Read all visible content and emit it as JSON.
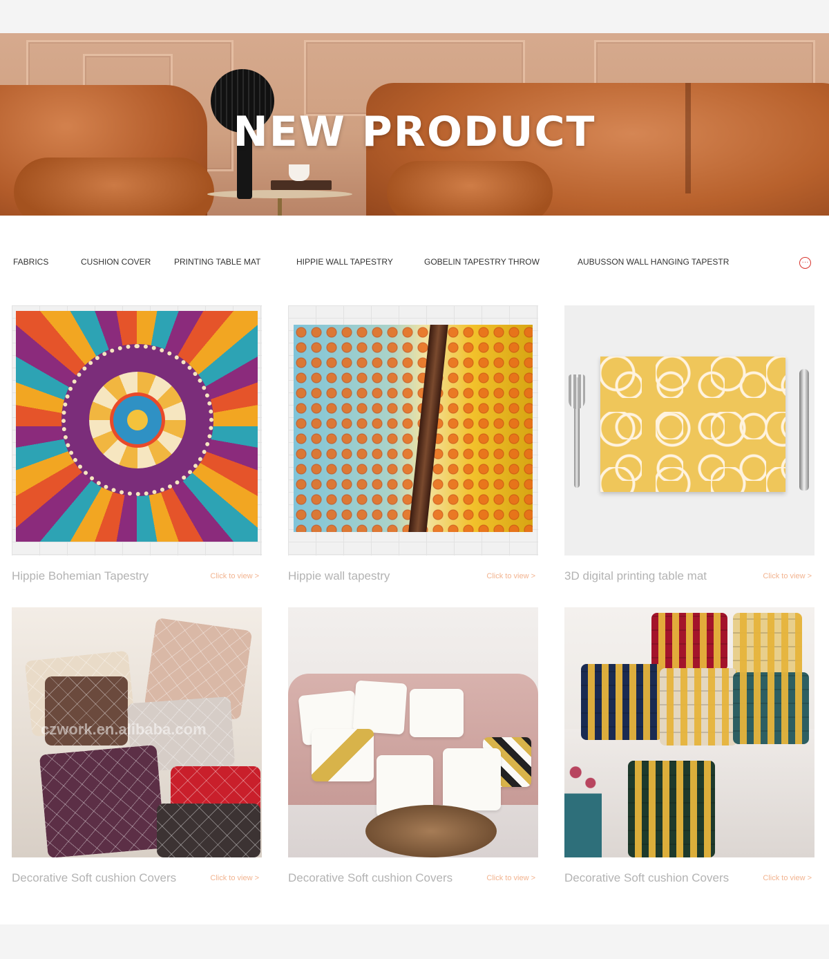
{
  "banner": {
    "title": "NEW PRODUCT"
  },
  "nav": {
    "categories": [
      "FABRICS",
      "CUSHION COVER",
      "PRINTING TABLE MAT",
      "HIPPIE WALL TAPESTRY",
      "GOBELIN TAPESTRY THROW",
      "AUBUSSON WALL HANGING TAPESTR"
    ],
    "more_icon": "ellipsis-circle-icon",
    "accent_color": "#d8322b"
  },
  "products": [
    {
      "name": "Hippie Bohemian Tapestry",
      "link": "Click to view >"
    },
    {
      "name": "Hippie wall tapestry",
      "link": "Click to view >"
    },
    {
      "name": "3D digital printing table mat",
      "link": "Click to view >"
    },
    {
      "name": "Decorative Soft cushion Covers",
      "link": "Click to view >"
    },
    {
      "name": "Decorative Soft cushion Covers",
      "link": "Click to view >"
    },
    {
      "name": "Decorative Soft cushion Covers",
      "link": "Click to view >"
    }
  ],
  "watermark": "czwork.en.alibaba.com",
  "colors": {
    "product_name": "#b3b3b3",
    "link": "#f2b38f"
  }
}
